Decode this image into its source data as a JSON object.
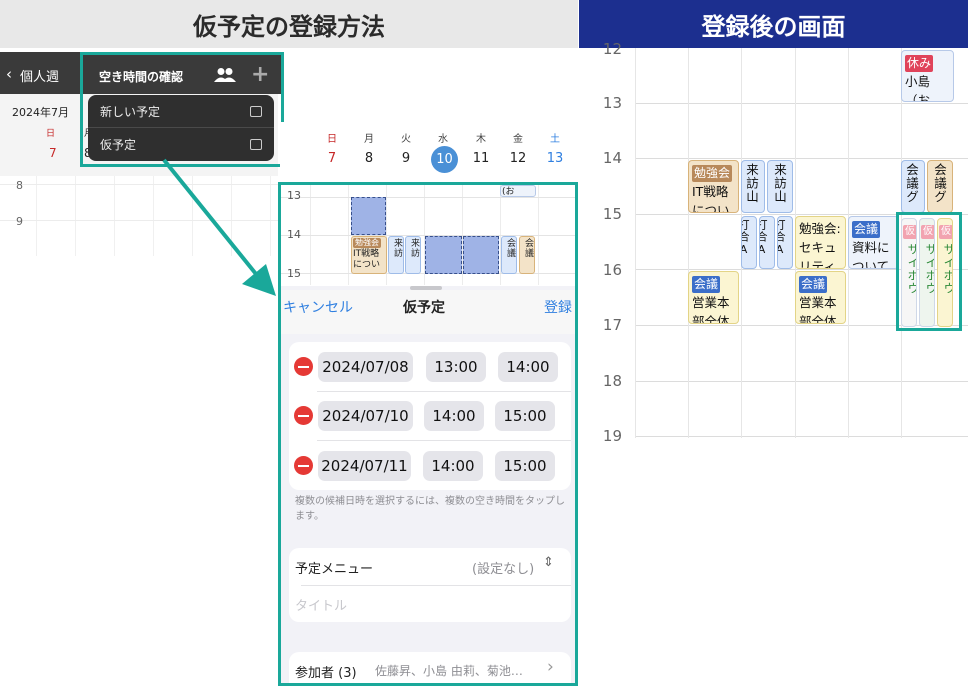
{
  "left": {
    "banner": "仮予定の登録方法",
    "top_calendar": {
      "back_label": "個人週",
      "month_label": "2024年7月",
      "weekday_sun": "日",
      "weekday_mon": "月",
      "day_sun": "7",
      "day_mon": "8",
      "hours": [
        "8",
        "9"
      ]
    },
    "popup": {
      "title": "空き時間の確認",
      "menu": [
        {
          "label": "新しい予定"
        },
        {
          "label": "仮予定"
        }
      ]
    },
    "week_strip": {
      "weekdays": [
        "日",
        "月",
        "火",
        "水",
        "木",
        "金",
        "土"
      ],
      "days": [
        "7",
        "8",
        "9",
        "10",
        "11",
        "12",
        "13"
      ],
      "selected_day": "10"
    },
    "mini_calendar": {
      "hours": [
        "13",
        "14",
        "15"
      ],
      "event_labels": {
        "study": "勉強会",
        "study_line1": "IT戦略",
        "study_line2": "につい",
        "visit": "来訪",
        "meeting": "会議",
        "note": "(お"
      }
    },
    "sheet": {
      "cancel_label": "キャンセル",
      "title": "仮予定",
      "register_label": "登録",
      "rows": [
        {
          "date": "2024/07/08",
          "start": "13:00",
          "end": "14:00"
        },
        {
          "date": "2024/07/10",
          "start": "14:00",
          "end": "15:00"
        },
        {
          "date": "2024/07/11",
          "start": "14:00",
          "end": "15:00"
        }
      ],
      "hint": "複数の候補日時を選択するには、複数の空き時間をタップします。",
      "menu_label": "予定メニュー",
      "menu_value": "(設定なし)",
      "title_placeholder": "タイトル",
      "participants_label": "参加者 (3)",
      "participants_value": "佐藤昇、小島 由莉、菊池…"
    }
  },
  "right": {
    "banner": "登録後の画面",
    "hours": [
      "12",
      "13",
      "14",
      "15",
      "16",
      "17",
      "18",
      "19"
    ],
    "events": {
      "rest_tag": "休み",
      "rest_name": "小島",
      "rest_note": "（お",
      "study_tag": "勉強会",
      "study_line1": "IT戦略",
      "study_line2": "につい",
      "visit1": "来訪山",
      "visit2": "来訪山",
      "meeting_tag": "会議",
      "meeting_v": "会議グ",
      "meeting_v2": "会議グ",
      "meet_a1": "打合A",
      "meet_a2": "打合A",
      "meet_a3": "打合A",
      "study2_line1": "勉強会:",
      "study2_line2": "セキュ",
      "study2_line3": "リティ",
      "doc_tag": "会議",
      "doc_line1": "資料に",
      "doc_line2": "ついて",
      "dept1_tag": "会議",
      "dept1_line1": "営業本",
      "dept1_line2": "部全体",
      "dept2_tag": "会議",
      "dept2_line1": "営業本",
      "dept2_line2": "部全体",
      "tent_tag": "仮",
      "tent1": "サイボウ",
      "tent2": "サイボウ",
      "tent3": "サイボウ"
    }
  },
  "colors": {
    "accent_teal": "#1aa89a",
    "banner_blue": "#1c2f8f",
    "ios_blue": "#2f7fe0",
    "selected_day": "#4a90d6",
    "delete_red": "#e53935"
  }
}
